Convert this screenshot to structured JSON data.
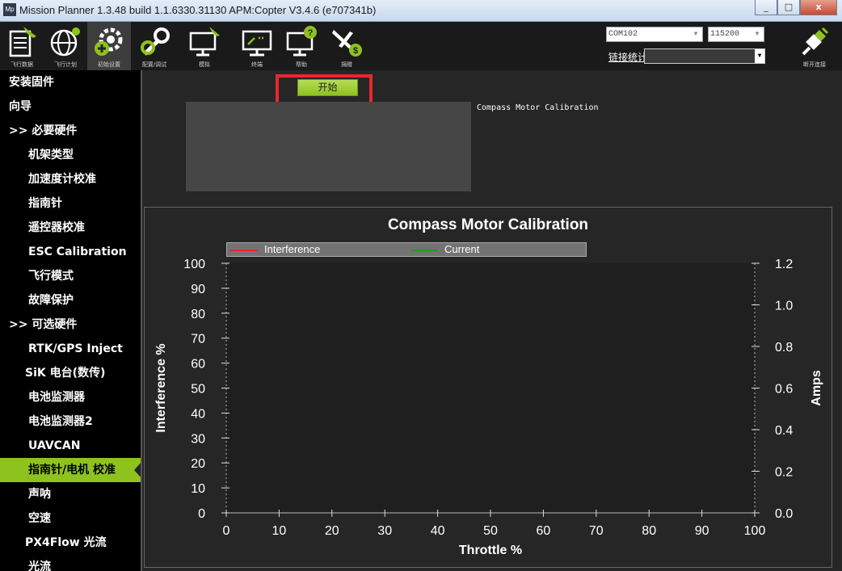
{
  "window": {
    "icon_text": "Mp",
    "title": "Mission Planner 1.3.48 build 1.1.6330.31130 APM:Copter V3.4.6 (e707341b)",
    "buttons": [
      "_",
      "□",
      "x"
    ]
  },
  "toolbar": {
    "items": [
      {
        "label": "飞行数据",
        "icon": "flight-data-icon"
      },
      {
        "label": "飞行计划",
        "icon": "flight-plan-icon"
      },
      {
        "label": "初始设置",
        "icon": "initial-setup-icon"
      },
      {
        "label": "配置/调试",
        "icon": "config-tuning-icon"
      },
      {
        "label": "模拟",
        "icon": "simulation-icon"
      },
      {
        "label": "终端",
        "icon": "terminal-icon"
      },
      {
        "label": "帮助",
        "icon": "help-icon"
      },
      {
        "label": "捐赠",
        "icon": "donate-icon"
      }
    ],
    "port": "COM102",
    "baud": "115200",
    "link_stats": "链接统计",
    "link_select": "",
    "disconnect_label": "断开连接"
  },
  "sidebar": {
    "items": [
      {
        "label": "安装固件",
        "level": 0
      },
      {
        "label": "向导",
        "level": 0
      },
      {
        "label": ">> 必要硬件",
        "level": 0
      },
      {
        "label": "机架类型",
        "level": 1
      },
      {
        "label": "加速度计校准",
        "level": 1
      },
      {
        "label": "指南针",
        "level": 1
      },
      {
        "label": "遥控器校准",
        "level": 1
      },
      {
        "label": "ESC Calibration",
        "level": 1
      },
      {
        "label": "飞行模式",
        "level": 1
      },
      {
        "label": "故障保护",
        "level": 1
      },
      {
        "label": ">> 可选硬件",
        "level": 0
      },
      {
        "label": "RTK/GPS Inject",
        "level": 1
      },
      {
        "label": "SiK 电台(数传)",
        "level": 1
      },
      {
        "label": "电池监测器",
        "level": 1
      },
      {
        "label": "电池监测器2",
        "level": 1
      },
      {
        "label": "UAVCAN",
        "level": 1
      },
      {
        "label": "指南针/电机 校准",
        "level": 1,
        "active": true
      },
      {
        "label": "声呐",
        "level": 1
      },
      {
        "label": "空速",
        "level": 1
      },
      {
        "label": "PX4Flow 光流",
        "level": 1
      },
      {
        "label": "光流",
        "level": 1
      }
    ]
  },
  "main": {
    "start_button": "开始",
    "log_label": "Compass Motor Calibration",
    "log_text": ""
  },
  "colors": {
    "accent_green": "#8ec21f",
    "highlight_red": "#e8282c",
    "interference": "#e8282c",
    "current": "#1aa01a"
  },
  "chart_data": {
    "type": "line",
    "title": "Compass Motor Calibration",
    "xlabel": "Throttle %",
    "ylabel": "Interference %",
    "y2label": "Amps",
    "xlim": [
      0,
      100
    ],
    "ylim": [
      0,
      100
    ],
    "y2lim": [
      0,
      1.2
    ],
    "x_ticks": [
      "0",
      "10",
      "20",
      "30",
      "40",
      "50",
      "60",
      "70",
      "80",
      "90",
      "100"
    ],
    "y_ticks": [
      "0",
      "10",
      "20",
      "30",
      "40",
      "50",
      "60",
      "70",
      "80",
      "90",
      "100"
    ],
    "y2_ticks": [
      "0.0",
      "0.2",
      "0.4",
      "0.6",
      "0.8",
      "1.0",
      "1.2"
    ],
    "legend_position": "top",
    "grid": false,
    "series": [
      {
        "name": "Interference",
        "color": "#e8282c",
        "axis": "left",
        "x": [],
        "y": []
      },
      {
        "name": "Current",
        "color": "#1aa01a",
        "axis": "right",
        "x": [],
        "y": []
      }
    ]
  }
}
